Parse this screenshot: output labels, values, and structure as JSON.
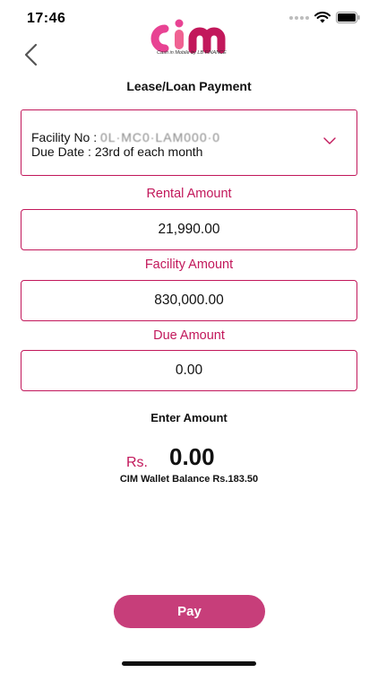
{
  "status_bar": {
    "time": "17:46"
  },
  "logo": {
    "text": "cim",
    "tagline": "Cash in Mobile by LB FINANCE",
    "colors": [
      "#e84393",
      "#f06292",
      "#c2185b"
    ]
  },
  "header": {
    "back_icon": "chevron-left-icon",
    "title": "Lease/Loan Payment"
  },
  "facility": {
    "facility_label": "Facility No : ",
    "facility_value": "0L·MC0·LAM000·0",
    "due_label": "Due Date : ",
    "due_value": "23rd of each month",
    "dropdown_icon": "chevron-down-icon"
  },
  "fields": {
    "rental_label": "Rental Amount",
    "rental_value": "21,990.00",
    "facility_amount_label": "Facility Amount",
    "facility_amount_value": "830,000.00",
    "due_amount_label": "Due Amount",
    "due_amount_value": "0.00"
  },
  "payment": {
    "enter_label": "Enter Amount",
    "currency": "Rs.",
    "amount": "0.00",
    "wallet_balance": "CIM Wallet Balance Rs.183.50",
    "pay_label": "Pay"
  },
  "colors": {
    "accent": "#c2185b",
    "button": "#c73e7a"
  }
}
